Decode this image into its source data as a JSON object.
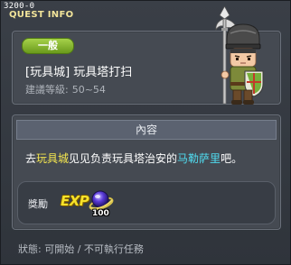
{
  "window": {
    "quest_id": "3200-0",
    "title": "QUEST INFO"
  },
  "quest": {
    "category": "一般",
    "name": "[玩具城] 玩具塔打扫",
    "level_label": "建議等級:",
    "level_range": "50~54"
  },
  "content": {
    "header": "內容",
    "desc_part1": "去",
    "desc_location": "玩具城",
    "desc_part2": "见见负责玩具塔治安的",
    "desc_npc": "马勒萨里",
    "desc_part3": "吧。"
  },
  "reward": {
    "label": "獎勵",
    "exp_label": "EXP",
    "exp_amount": "100"
  },
  "status": {
    "text": "狀態: 可開始 / 不可執行任務"
  },
  "icons": {
    "npc": "guard-npc-icon",
    "exp": "exp-orb-icon"
  },
  "colors": {
    "title": "#f2e49a",
    "category_badge": "#8ac033",
    "highlight_location": "#f4e64f",
    "highlight_npc": "#50dcf0",
    "exp_text": "#f6e22a"
  }
}
